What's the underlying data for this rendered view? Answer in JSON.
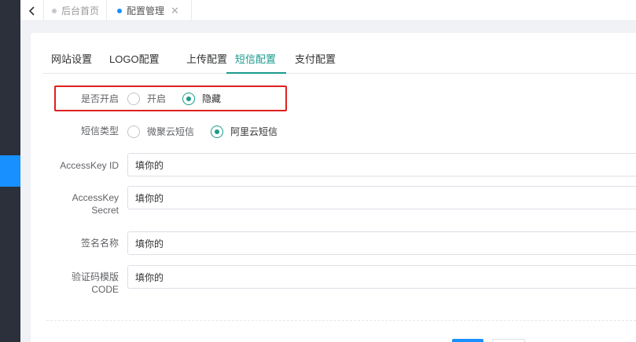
{
  "tabbar": {
    "tabs": [
      {
        "label": "后台首页",
        "active": false
      },
      {
        "label": "配置管理",
        "active": true
      }
    ]
  },
  "config_tabs": [
    "网站设置",
    "LOGO配置",
    "上传配置",
    "短信配置",
    "支付配置"
  ],
  "active_tab": "短信配置",
  "form": {
    "enable": {
      "label": "是否开启",
      "options": [
        "开启",
        "隐藏"
      ],
      "selected": "隐藏"
    },
    "sms_type": {
      "label": "短信类型",
      "options": [
        "微聚云短信",
        "阿里云短信"
      ],
      "selected": "阿里云短信"
    },
    "access_key_id": {
      "label": "AccessKey ID",
      "value": "填你的"
    },
    "access_key_secret": {
      "label_line1": "AccessKey",
      "label_line2": "Secret",
      "value": "填你的"
    },
    "sign_name": {
      "label": "签名名称",
      "value": "填你的"
    },
    "template_code": {
      "label_line1": "验证码模版",
      "label_line2": "CODE",
      "value": "填你的"
    }
  },
  "colors": {
    "accent": "#1a9b8c",
    "highlight": "#e02020",
    "sidebar": "#2b303b",
    "primary": "#1890ff"
  }
}
